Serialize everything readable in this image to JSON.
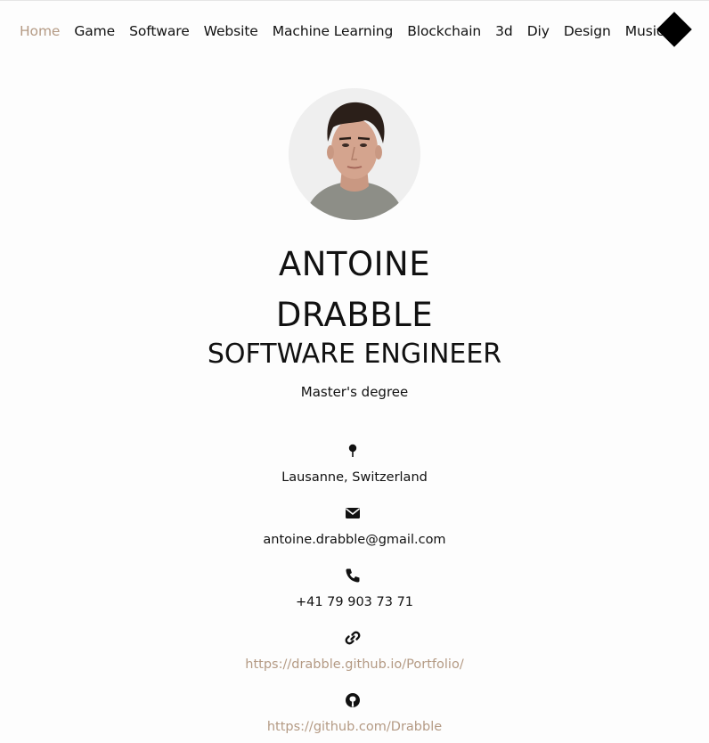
{
  "nav": {
    "items": [
      "Home",
      "Game",
      "Software",
      "Website",
      "Machine Learning",
      "Blockchain",
      "3d",
      "Diy",
      "Design",
      "Music"
    ],
    "active": "Home",
    "active_color": "#b49a84",
    "logo_icon": "diamond-logo-icon"
  },
  "profile": {
    "name_line1": "ANTOINE",
    "name_line2": "DRABBLE",
    "title": "SOFTWARE ENGINEER",
    "degree": "Master's degree"
  },
  "contact": {
    "location": "Lausanne, Switzerland",
    "email": "antoine.drabble@gmail.com",
    "phone": "+41 79 903 73 71",
    "portfolio": "https://drabble.github.io/Portfolio/",
    "github": "https://github.com/Drabble"
  },
  "icons": {
    "location": "map-pin-icon",
    "email": "envelope-icon",
    "phone": "phone-icon",
    "link": "link-icon",
    "github": "github-icon"
  },
  "colors": {
    "accent": "#b49a84",
    "text": "#111111",
    "background": "#fdfdfd"
  }
}
